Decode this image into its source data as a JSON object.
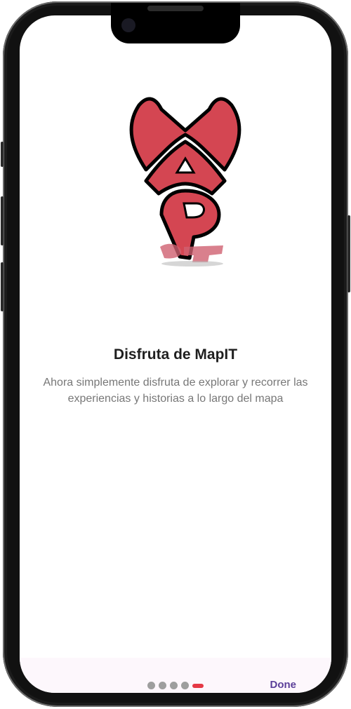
{
  "app": {
    "logo_lettering": "MapIT"
  },
  "onboarding": {
    "title": "Disfruta de MapIT",
    "description": "Ahora simplemente disfruta de explorar y recorrer las experiencias y historias a lo largo del mapa",
    "page_indicator": {
      "total": 5,
      "current": 5
    },
    "done_label": "Done"
  },
  "colors": {
    "brand_red": "#d44652",
    "active_dot": "#e53945",
    "inactive_dot": "#9e9e9e",
    "done_text": "#5b3f99"
  },
  "icons": {
    "logo": "mapit-pin-logo"
  }
}
